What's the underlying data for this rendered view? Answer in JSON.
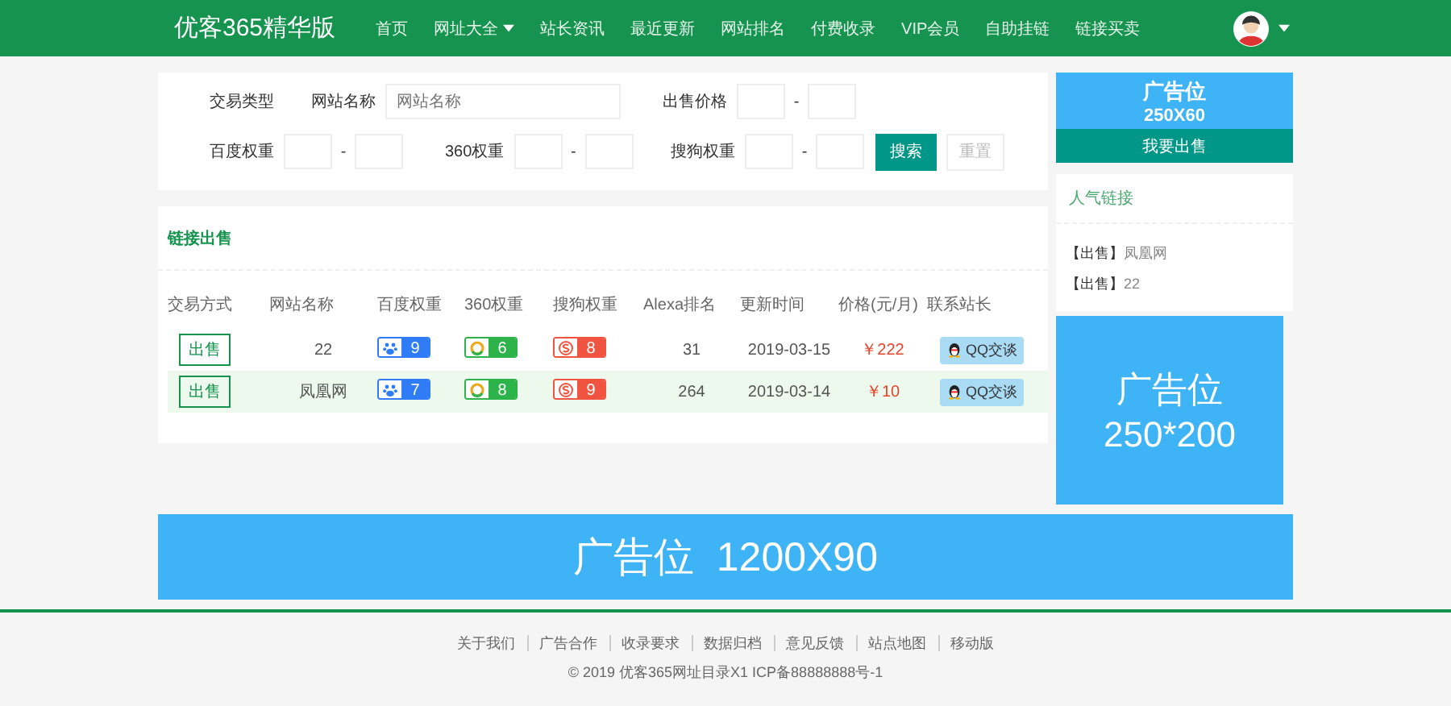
{
  "nav": {
    "logo": "优客365精华版",
    "items": [
      {
        "label": "首页",
        "dropdown": false
      },
      {
        "label": "网址大全",
        "dropdown": true
      },
      {
        "label": "站长资讯",
        "dropdown": false
      },
      {
        "label": "最近更新",
        "dropdown": false
      },
      {
        "label": "网站排名",
        "dropdown": false
      },
      {
        "label": "付费收录",
        "dropdown": false
      },
      {
        "label": "VIP会员",
        "dropdown": false
      },
      {
        "label": "自助挂链",
        "dropdown": false
      },
      {
        "label": "链接买卖",
        "dropdown": false
      }
    ]
  },
  "filter": {
    "rows": [
      [
        {
          "kind": "label",
          "label": "交易类型"
        },
        {
          "kind": "text",
          "label": "网站名称",
          "placeholder": "网站名称"
        },
        {
          "kind": "range",
          "label": "出售价格",
          "separator": "-"
        }
      ],
      [
        {
          "kind": "range",
          "label": "百度权重",
          "separator": "-"
        },
        {
          "kind": "range",
          "label": "360权重",
          "separator": "-"
        },
        {
          "kind": "range",
          "label": "搜狗权重",
          "separator": "-"
        }
      ]
    ],
    "search_button": "搜索",
    "reset_button": "重置"
  },
  "listing": {
    "title": "链接出售",
    "columns": [
      "交易方式",
      "网站名称",
      "百度权重",
      "360权重",
      "搜狗权重",
      "Alexa排名",
      "更新时间",
      "价格(元/月)",
      "联系站长"
    ],
    "rows": [
      {
        "type": "出售",
        "name": "22",
        "baidu": "9",
        "w360": "6",
        "sogou": "8",
        "alexa": "31",
        "updated": "2019-03-15",
        "price": "￥222",
        "contact": "QQ交谈",
        "highlighted": false
      },
      {
        "type": "出售",
        "name": "凤凰网",
        "baidu": "7",
        "w360": "8",
        "sogou": "9",
        "alexa": "264",
        "updated": "2019-03-14",
        "price": "￥10",
        "contact": "QQ交谈",
        "highlighted": true
      }
    ]
  },
  "sidebar": {
    "ad_top": {
      "title": "广告位",
      "size": "250X60"
    },
    "sell_button": "我要出售",
    "popular": {
      "title": "人气链接",
      "items": [
        {
          "tag": "【出售】",
          "name": "凤凰网"
        },
        {
          "tag": "【出售】",
          "name": "22"
        }
      ]
    },
    "ad_big": {
      "title": "广告位",
      "size": "250*200"
    }
  },
  "banner_ad": "广告位  1200X90",
  "footer": {
    "links": [
      "关于我们",
      "广告合作",
      "收录要求",
      "数据归档",
      "意见反馈",
      "站点地图",
      "移动版"
    ],
    "copyright": "© 2019 优客365网址目录X1 ICP备88888888号-1"
  }
}
